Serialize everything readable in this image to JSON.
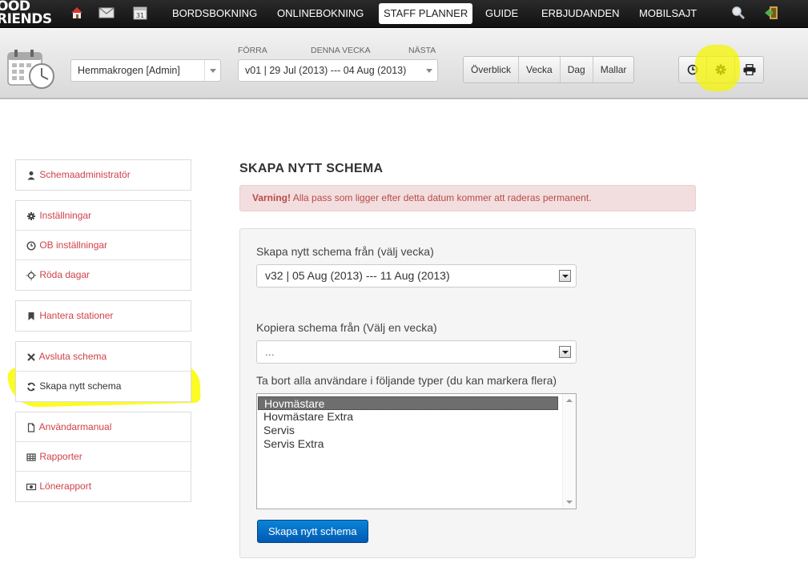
{
  "brand": {
    "line1": "OOD",
    "line2": "RIENDS"
  },
  "nav": {
    "items": [
      {
        "label": "BORDSBOKNING"
      },
      {
        "label": "ONLINEBOKNING"
      },
      {
        "label": "STAFF PLANNER"
      },
      {
        "label": "GUIDE"
      },
      {
        "label": "ERBJUDANDEN"
      },
      {
        "label": "MOBILSAJT"
      }
    ],
    "calendar_day": "31"
  },
  "toolbar": {
    "restaurant": "Hemmakrogen [Admin]",
    "prev_label": "FÖRRA",
    "this_week_label": "DENNA VECKA",
    "next_label": "NÄSTA",
    "week": "v01 | 29 Jul (2013) --- 04 Aug (2013)",
    "views": [
      "Överblick",
      "Vecka",
      "Dag",
      "Mallar"
    ]
  },
  "sidebar": {
    "groups": [
      [
        {
          "label": "Schemaadministratör",
          "icon": "user-icon"
        }
      ],
      [
        {
          "label": "Inställningar",
          "icon": "gear-icon"
        },
        {
          "label": "OB inställningar",
          "icon": "clock-icon"
        },
        {
          "label": "Röda dagar",
          "icon": "sun-icon"
        }
      ],
      [
        {
          "label": "Hantera stationer",
          "icon": "bookmark-icon"
        }
      ],
      [
        {
          "label": "Avsluta schema",
          "icon": "close-icon"
        },
        {
          "label": "Skapa nytt schema",
          "icon": "refresh-icon"
        }
      ],
      [
        {
          "label": "Användarmanual",
          "icon": "file-icon"
        },
        {
          "label": "Rapporter",
          "icon": "table-icon"
        },
        {
          "label": "Lönerapport",
          "icon": "money-icon"
        }
      ]
    ]
  },
  "main": {
    "title": "SKAPA NYTT SCHEMA",
    "alert_strong": "Varning!",
    "alert_text": " Alla pass som ligger efter detta datum kommer att raderas permanent.",
    "from_label": "Skapa nytt schema från (välj vecka)",
    "from_value": "v32 | 05 Aug (2013) --- 11 Aug (2013)",
    "copy_label": "Kopiera schema från (Välj en vecka)",
    "copy_value": "...",
    "remove_label": "Ta bort alla användare i följande typer (du kan markera flera)",
    "user_types": [
      "Hovmästare",
      "Hovmästare Extra",
      "Servis",
      "Servis Extra"
    ],
    "submit_label": "Skapa nytt schema"
  }
}
